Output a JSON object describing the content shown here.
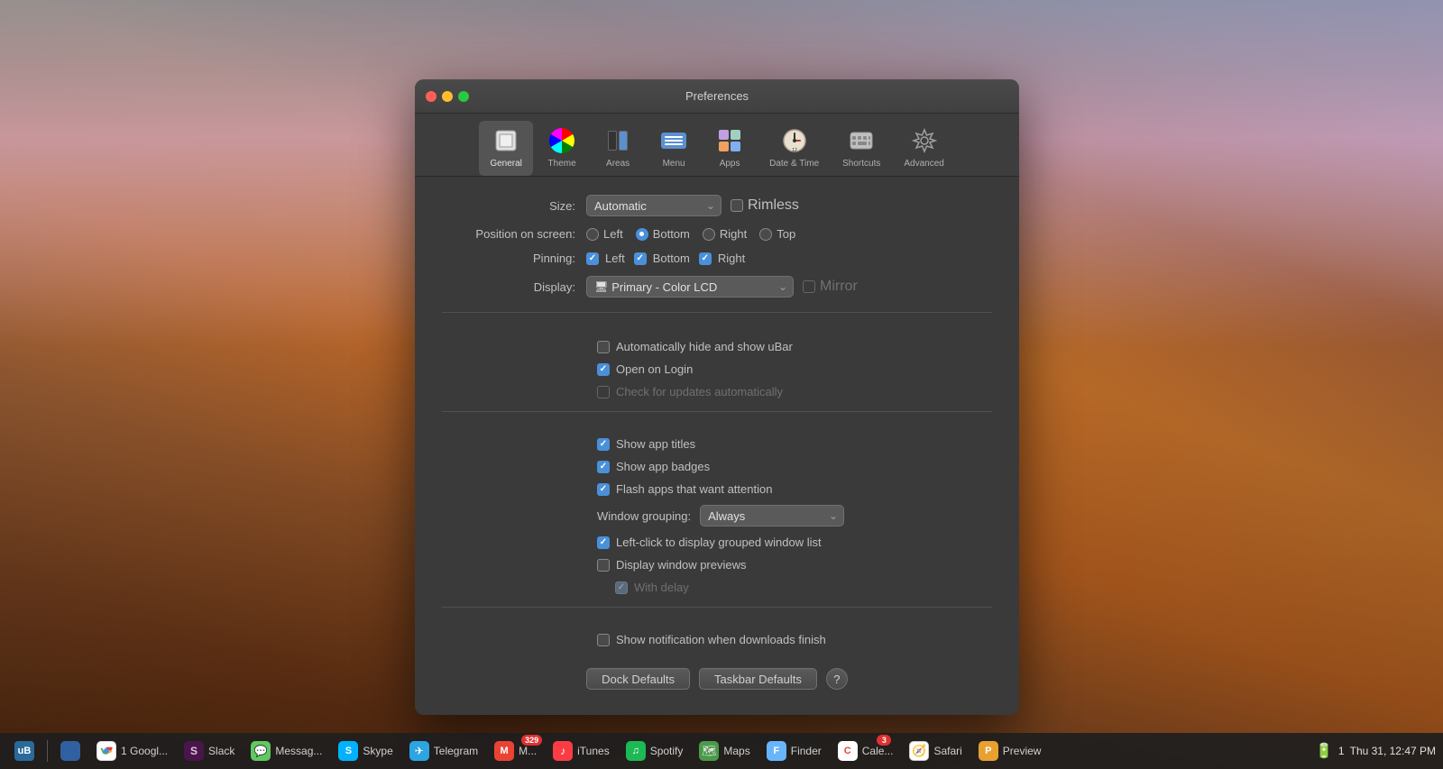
{
  "window": {
    "title": "Preferences"
  },
  "toolbar": {
    "items": [
      {
        "id": "general",
        "label": "General",
        "icon": "🖥"
      },
      {
        "id": "theme",
        "label": "Theme",
        "icon": "theme"
      },
      {
        "id": "areas",
        "label": "Areas",
        "icon": "areas"
      },
      {
        "id": "menu",
        "label": "Menu",
        "icon": "menu"
      },
      {
        "id": "apps",
        "label": "Apps",
        "icon": "🅰"
      },
      {
        "id": "datetime",
        "label": "Date & Time",
        "icon": "⏰"
      },
      {
        "id": "shortcuts",
        "label": "Shortcuts",
        "icon": "⌨"
      },
      {
        "id": "advanced",
        "label": "Advanced",
        "icon": "⚙"
      }
    ],
    "active": "general"
  },
  "form": {
    "size_label": "Size:",
    "size_value": "Automatic",
    "rimless_label": "Rimless",
    "position_label": "Position on screen:",
    "position_options": [
      {
        "label": "Left",
        "checked": false
      },
      {
        "label": "Bottom",
        "checked": true
      },
      {
        "label": "Right",
        "checked": false
      },
      {
        "label": "Top",
        "checked": false
      }
    ],
    "pinning_label": "Pinning:",
    "pinning_options": [
      {
        "label": "Left",
        "checked": true
      },
      {
        "label": "Bottom",
        "checked": true
      },
      {
        "label": "Right",
        "checked": true
      }
    ],
    "display_label": "Display:",
    "display_value": "Primary - Color LCD",
    "mirror_label": "Mirror",
    "auto_hide_label": "Automatically hide and show uBar",
    "auto_hide_checked": false,
    "open_login_label": "Open on Login",
    "open_login_checked": true,
    "check_updates_label": "Check for updates automatically",
    "check_updates_checked": false,
    "check_updates_disabled": true,
    "show_titles_label": "Show app titles",
    "show_titles_checked": true,
    "show_badges_label": "Show app badges",
    "show_badges_checked": true,
    "flash_apps_label": "Flash apps that want attention",
    "flash_apps_checked": true,
    "window_grouping_label": "Window grouping:",
    "window_grouping_value": "Always",
    "left_click_label": "Left-click to display grouped window list",
    "left_click_checked": true,
    "display_previews_label": "Display window previews",
    "display_previews_checked": false,
    "with_delay_label": "With delay",
    "with_delay_checked": false,
    "with_delay_disabled": true,
    "show_notification_label": "Show notification when downloads finish",
    "show_notification_checked": false,
    "dock_defaults_label": "Dock Defaults",
    "taskbar_defaults_label": "Taskbar Defaults",
    "help_label": "?"
  },
  "taskbar": {
    "items": [
      {
        "label": "uB",
        "type": "ubar"
      },
      {
        "icon": "🟦",
        "label": ""
      },
      {
        "icon": "G",
        "label": "1 Googl...",
        "color": "#4a8af4"
      },
      {
        "icon": "💬",
        "label": "Slack"
      },
      {
        "icon": "💬",
        "label": "Messag..."
      },
      {
        "icon": "S",
        "label": "Skype",
        "color": "#00b2ff"
      },
      {
        "icon": "✈",
        "label": "Telegram",
        "color": "#2ca5e0"
      },
      {
        "icon": "M",
        "label": "M...",
        "badge": "329",
        "color": "#ea4335"
      },
      {
        "icon": "♪",
        "label": "iTunes",
        "color": "#fc3c44"
      },
      {
        "icon": "S",
        "label": "Spotify",
        "color": "#1db954"
      },
      {
        "icon": "🗺",
        "label": "Maps"
      },
      {
        "icon": "F",
        "label": "Finder",
        "color": "#68b5fb"
      },
      {
        "icon": "C",
        "label": "Cale...",
        "badge": "3",
        "color": "#ea4335"
      },
      {
        "icon": "S",
        "label": "Safari",
        "color": "#006cff"
      },
      {
        "icon": "P",
        "label": "Preview",
        "color": "#e8a030"
      }
    ],
    "right": {
      "battery": "🔋",
      "wifi": "1",
      "time": "Thu 31, 12:47 PM"
    }
  }
}
